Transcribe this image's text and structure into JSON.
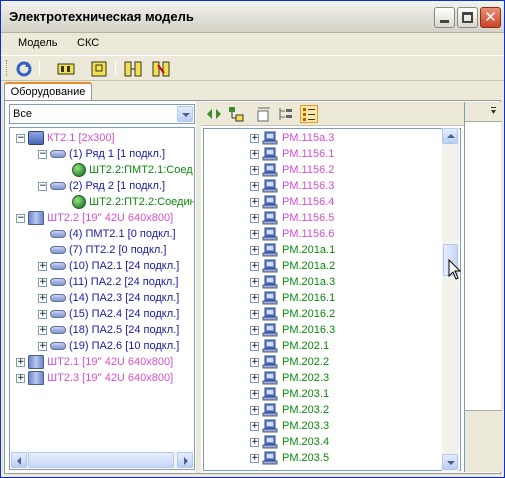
{
  "window": {
    "title": "Электротехническая модель"
  },
  "menu": {
    "items": [
      "Модель",
      "СКС"
    ]
  },
  "tabs": {
    "equipment": "Оборудование"
  },
  "filter": {
    "selected": "Все"
  },
  "left_tree": [
    {
      "label": "КТ2.1 [2x300]",
      "color": "pink",
      "icon": "cabinet-icon",
      "level": 0,
      "expander": "minus"
    },
    {
      "label": "(1) Ряд 1 [1 подкл.]",
      "color": "blue",
      "icon": "patch-panel-icon",
      "level": 1,
      "expander": "minus"
    },
    {
      "label": "ШТ2.2:ПМТ2.1:Соед",
      "color": "green",
      "icon": "network-globe-icon",
      "level": 2,
      "expander": ""
    },
    {
      "label": "(2) Ряд 2 [1 подкл.]",
      "color": "blue",
      "icon": "patch-panel-icon",
      "level": 1,
      "expander": "minus"
    },
    {
      "label": "ШТ2.2:ПТ2.2:Соедин",
      "color": "green",
      "icon": "network-globe-icon",
      "level": 2,
      "expander": ""
    },
    {
      "label": "ШТ2.2 [19'' 42U 640x800]",
      "color": "pink",
      "icon": "rack-icon",
      "level": 0,
      "expander": "minus"
    },
    {
      "label": "(4) ПМТ2.1 [0 подкл.]",
      "color": "blue",
      "icon": "patch-panel-icon",
      "level": 1,
      "expander": ""
    },
    {
      "label": "(7) ПТ2.2 [0 подкл.]",
      "color": "blue",
      "icon": "patch-panel-icon",
      "level": 1,
      "expander": ""
    },
    {
      "label": "(10) ПА2.1 [24 подкл.]",
      "color": "blue",
      "icon": "patch-panel-icon",
      "level": 1,
      "expander": "plus"
    },
    {
      "label": "(11) ПА2.2 [24 подкл.]",
      "color": "blue",
      "icon": "patch-panel-icon",
      "level": 1,
      "expander": "plus"
    },
    {
      "label": "(14) ПА2.3 [24 подкл.]",
      "color": "blue",
      "icon": "patch-panel-icon",
      "level": 1,
      "expander": "plus"
    },
    {
      "label": "(15) ПА2.4 [24 подкл.]",
      "color": "blue",
      "icon": "patch-panel-icon",
      "level": 1,
      "expander": "plus"
    },
    {
      "label": "(18) ПА2.5 [24 подкл.]",
      "color": "blue",
      "icon": "patch-panel-icon",
      "level": 1,
      "expander": "plus"
    },
    {
      "label": "(19) ПА2.6 [10 подкл.]",
      "color": "blue",
      "icon": "patch-panel-icon",
      "level": 1,
      "expander": "plus"
    },
    {
      "label": "ШТ2.1 [19'' 42U 640x800]",
      "color": "pink",
      "icon": "rack-icon",
      "level": 0,
      "expander": "plus"
    },
    {
      "label": "ШТ2.3 [19'' 42U 640x800]",
      "color": "pink",
      "icon": "rack-icon",
      "level": 0,
      "expander": "plus"
    }
  ],
  "right_tree": [
    {
      "label": "PM.115a.3",
      "color": "pink"
    },
    {
      "label": "PM.1156.1",
      "color": "pink"
    },
    {
      "label": "PM.1156.2",
      "color": "pink"
    },
    {
      "label": "PM.1156.3",
      "color": "pink"
    },
    {
      "label": "PM.1156.4",
      "color": "pink"
    },
    {
      "label": "PM.1156.5",
      "color": "pink"
    },
    {
      "label": "PM.1156.6",
      "color": "pink"
    },
    {
      "label": "PM.201a.1",
      "color": "green"
    },
    {
      "label": "PM.201a.2",
      "color": "green"
    },
    {
      "label": "PM.201a.3",
      "color": "green"
    },
    {
      "label": "PM.2016.1",
      "color": "green"
    },
    {
      "label": "PM.2016.2",
      "color": "green"
    },
    {
      "label": "PM.2016.3",
      "color": "green"
    },
    {
      "label": "PM.202.1",
      "color": "green"
    },
    {
      "label": "PM.202.2",
      "color": "green"
    },
    {
      "label": "PM.202.3",
      "color": "green"
    },
    {
      "label": "PM.203.1",
      "color": "green"
    },
    {
      "label": "PM.203.2",
      "color": "green"
    },
    {
      "label": "PM.203.3",
      "color": "green"
    },
    {
      "label": "PM.203.4",
      "color": "green"
    },
    {
      "label": "PM.203.5",
      "color": "green"
    }
  ],
  "colors": {
    "pink": "#D44FD0",
    "blue": "#1A1AA6",
    "green": "#0A8A0A",
    "selection_orange": "#E68B2C"
  }
}
